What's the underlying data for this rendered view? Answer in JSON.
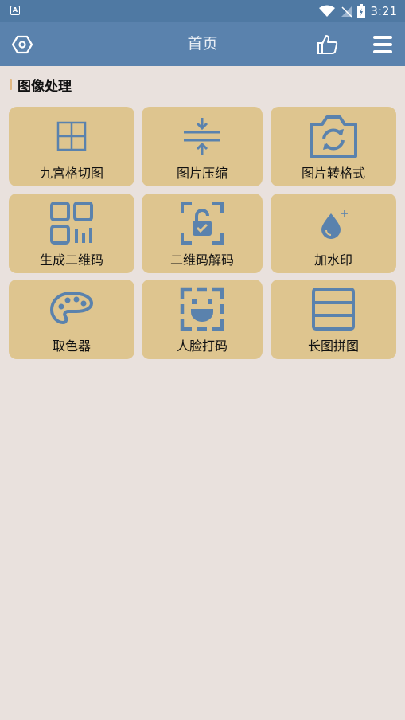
{
  "status_bar": {
    "time": "3:21",
    "notification_icon_letter": "A"
  },
  "app_bar": {
    "title": "首页"
  },
  "section": {
    "title": "图像处理"
  },
  "tiles": [
    {
      "label": "九宫格切图",
      "icon": "grid-cut-icon"
    },
    {
      "label": "图片压缩",
      "icon": "compress-icon"
    },
    {
      "label": "图片转格式",
      "icon": "camera-rotate-icon"
    },
    {
      "label": "生成二维码",
      "icon": "qrcode-icon"
    },
    {
      "label": "二维码解码",
      "icon": "lock-scan-icon"
    },
    {
      "label": "加水印",
      "icon": "water-drop-icon"
    },
    {
      "label": "取色器",
      "icon": "palette-icon"
    },
    {
      "label": "人脸打码",
      "icon": "face-scan-icon"
    },
    {
      "label": "长图拼图",
      "icon": "long-image-icon"
    }
  ],
  "colors": {
    "primary": "#5a82ad",
    "tile_bg": "#dec58f",
    "icon": "#5a82ad",
    "background": "#e9e1dd",
    "accent_bar": "#e0b884"
  }
}
